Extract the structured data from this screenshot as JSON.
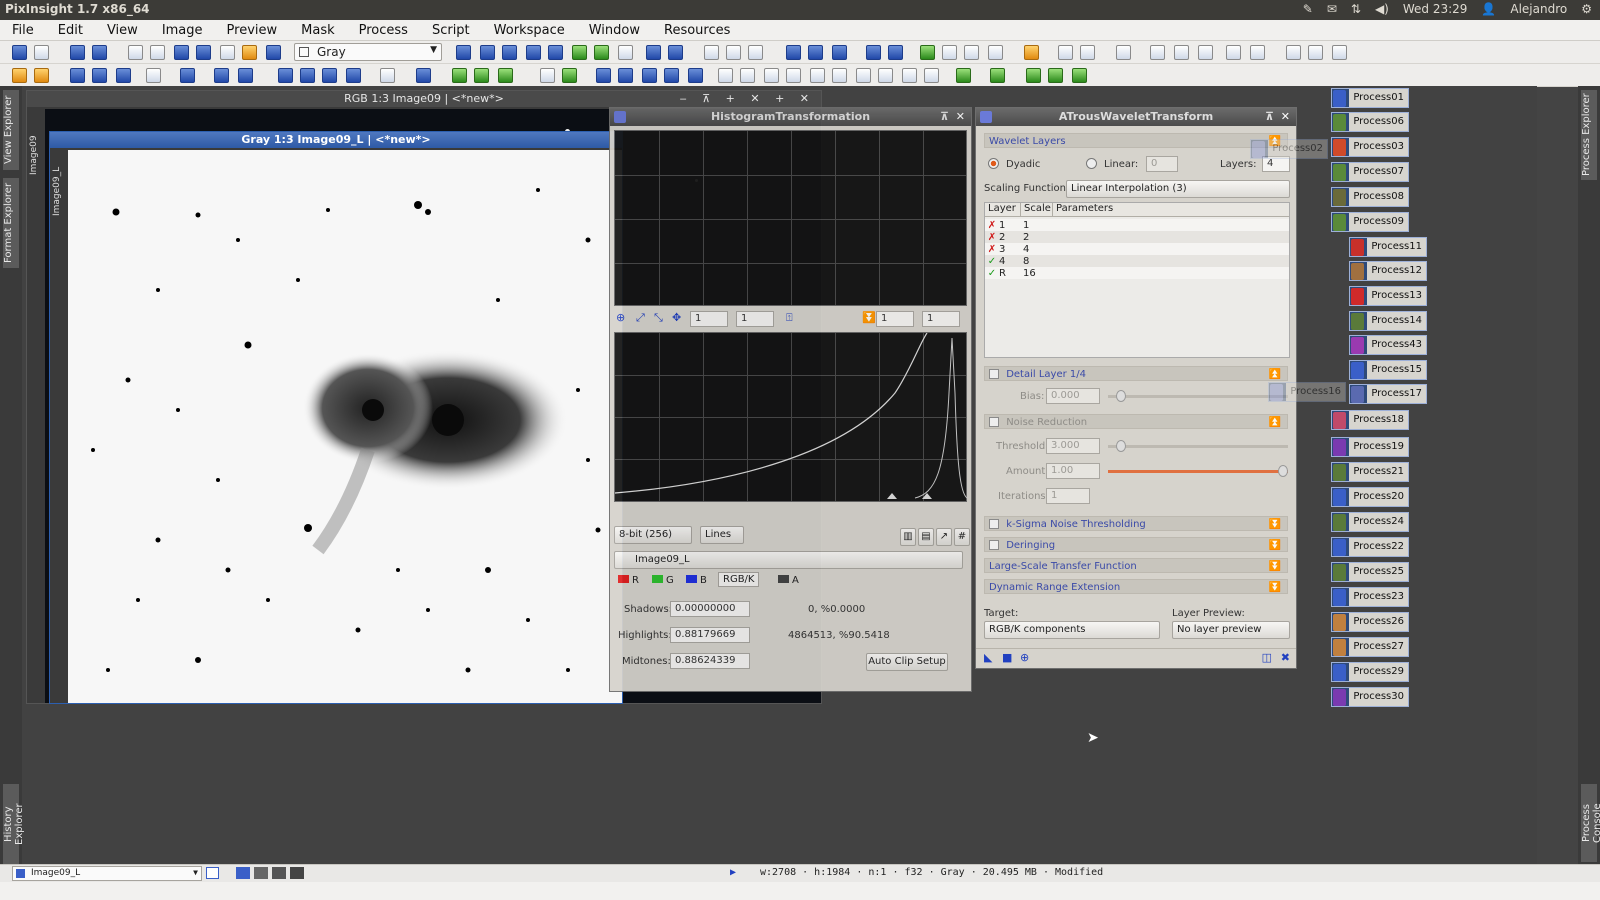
{
  "system": {
    "app_title": "PixInsight 1.7 x86_64",
    "clock": "Wed 23:29",
    "user": "Alejandro"
  },
  "menu": [
    "File",
    "Edit",
    "View",
    "Image",
    "Preview",
    "Mask",
    "Process",
    "Script",
    "Workspace",
    "Window",
    "Resources"
  ],
  "toolbar": {
    "colorspace_select": "Gray"
  },
  "side_tabs": {
    "view_explorer": "View Explorer",
    "format_explorer": "Format Explorer",
    "history_explorer": "History Explorer",
    "process_explorer": "Process Explorer",
    "process_console": "Process Console"
  },
  "windows": {
    "rgb_title": "RGB 1:3 Image09 | <*new*>",
    "rgb_side": "Image09",
    "gray_title": "Gray 1:3 Image09_L | <*new*>",
    "gray_side": "Image09_L"
  },
  "histogram": {
    "title": "HistogramTransformation",
    "zoom_h": "1",
    "zoom_v": "1",
    "zoom2_h": "1",
    "zoom2_v": "1",
    "resolution": "8-bit (256)",
    "graph_style": "Lines",
    "view": "Image09_L",
    "channels": [
      "R",
      "G",
      "B",
      "RGB/K",
      "A"
    ],
    "shadows_label": "Shadows:",
    "shadows_value": "0.00000000",
    "shadows_clip": "0, %0.0000",
    "highlights_label": "Highlights:",
    "highlights_value": "0.88179669",
    "highlights_clip": "4864513, %90.5418",
    "midtones_label": "Midtones:",
    "midtones_value": "0.88624339",
    "auto_clip": "Auto Clip Setup"
  },
  "atrous": {
    "title": "ATrousWaveletTransform",
    "wavelet_layers": "Wavelet Layers",
    "dyadic": "Dyadic",
    "linear": "Linear:",
    "linear_value": "0",
    "layers_label": "Layers:",
    "layers_value": "4",
    "scaling_label": "Scaling Function:",
    "scaling_value": "Linear Interpolation (3)",
    "columns": [
      "Layer",
      "Scale",
      "Parameters"
    ],
    "rows": [
      {
        "state": "✗",
        "layer": "1",
        "scale": "1"
      },
      {
        "state": "✗",
        "layer": "2",
        "scale": "2"
      },
      {
        "state": "✗",
        "layer": "3",
        "scale": "4"
      },
      {
        "state": "✓",
        "layer": "4",
        "scale": "8"
      },
      {
        "state": "✓",
        "layer": "R",
        "scale": "16"
      }
    ],
    "detail_layer": "Detail Layer 1/4",
    "bias_label": "Bias:",
    "bias_value": "0.000",
    "noise_reduction": "Noise Reduction",
    "threshold_label": "Threshold:",
    "threshold_value": "3.000",
    "amount_label": "Amount:",
    "amount_value": "1.00",
    "iterations_label": "Iterations:",
    "iterations_value": "1",
    "ksigma": "k-Sigma Noise Thresholding",
    "deringing": "Deringing",
    "large_scale": "Large-Scale Transfer Function",
    "dynamic_range": "Dynamic Range Extension",
    "target_label": "Target:",
    "target_value": "RGB/K components",
    "layer_preview_label": "Layer Preview:",
    "layer_preview_value": "No layer preview"
  },
  "process_icons": [
    {
      "label": "Process01",
      "color": "#3a5fc8"
    },
    {
      "label": "Process06",
      "color": "#5a8a3a"
    },
    {
      "label": "Process03",
      "color": "#d04a2a"
    },
    {
      "label": "Process07",
      "color": "#5a8a3a"
    },
    {
      "label": "Process08",
      "color": "#6a6a3a"
    },
    {
      "label": "Process09",
      "color": "#5a8a3a"
    },
    {
      "label": "Process11",
      "color": "#c8302a"
    },
    {
      "label": "Process12",
      "color": "#a07040"
    },
    {
      "label": "Process13",
      "color": "#d02a2a"
    },
    {
      "label": "Process14",
      "color": "#5a7a3a"
    },
    {
      "label": "Process43",
      "color": "#9a3ab0"
    },
    {
      "label": "Process15",
      "color": "#3a5fc8"
    },
    {
      "label": "Process17",
      "color": "#5a6ab0"
    },
    {
      "label": "Process18",
      "color": "#c04a6a"
    },
    {
      "label": "Process19",
      "color": "#7a3ab0"
    },
    {
      "label": "Process21",
      "color": "#5a7a3a"
    },
    {
      "label": "Process20",
      "color": "#3a5fc8"
    },
    {
      "label": "Process24",
      "color": "#5a7a3a"
    },
    {
      "label": "Process22",
      "color": "#3a5fc8"
    },
    {
      "label": "Process25",
      "color": "#5a7a3a"
    },
    {
      "label": "Process23",
      "color": "#3a5fc8"
    },
    {
      "label": "Process26",
      "color": "#c08040"
    },
    {
      "label": "Process27",
      "color": "#c08040"
    },
    {
      "label": "Process29",
      "color": "#3a5fc8"
    },
    {
      "label": "Process30",
      "color": "#7a3ab0"
    }
  ],
  "ghost_icons": {
    "p02": "Process02",
    "p16": "Process16"
  },
  "status": {
    "view_name": "Image09_L",
    "info": "w:2708 · h:1984 · n:1 · f32 · Gray · 20.495 MB · Modified"
  }
}
